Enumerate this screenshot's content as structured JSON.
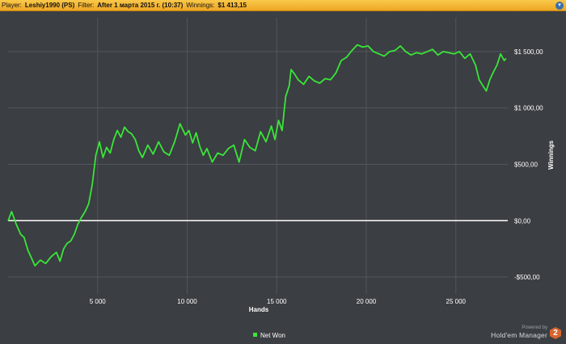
{
  "header": {
    "player_label": "Player:",
    "player_value": "Leshiy1990 (PS)",
    "filter_label": "Filter:",
    "filter_value": "After 1 марта 2015 г. (10:37)",
    "winnings_label": "Winnings:",
    "winnings_value": "$1 413,15",
    "menu_icon": "chevron-down-icon"
  },
  "branding": {
    "powered_by": "Powered by",
    "product": "Hold'em Manager",
    "badge": "2"
  },
  "colors": {
    "background": "#3b3e42",
    "grid": "#53575c",
    "line": "#39e639",
    "zero_line": "#ffffff"
  },
  "chart_data": {
    "type": "line",
    "xlabel": "Hands",
    "ylabel": "Winnings",
    "x_ticks": [
      "5 000",
      "10 000",
      "15 000",
      "20 000",
      "25 000"
    ],
    "x_tick_values": [
      5000,
      10000,
      15000,
      20000,
      25000
    ],
    "y_ticks": [
      "$1 500,00",
      "$1 000,00",
      "$500,00",
      "$0,00",
      "-$500,00"
    ],
    "y_tick_values": [
      1500,
      1000,
      500,
      0,
      -500
    ],
    "xlim": [
      0,
      27900
    ],
    "ylim": [
      -650,
      1800
    ],
    "grid": true,
    "legend_position": "bottom-center",
    "series": [
      {
        "name": "Net Won",
        "x": [
          0,
          200,
          450,
          700,
          900,
          1100,
          1300,
          1500,
          1800,
          2100,
          2400,
          2700,
          2900,
          3100,
          3300,
          3500,
          3700,
          3900,
          4100,
          4300,
          4500,
          4700,
          4900,
          5100,
          5300,
          5500,
          5700,
          5900,
          6100,
          6300,
          6500,
          6700,
          6900,
          7100,
          7300,
          7500,
          7800,
          8100,
          8400,
          8700,
          9000,
          9300,
          9600,
          9900,
          10100,
          10300,
          10500,
          10700,
          10900,
          11100,
          11400,
          11700,
          12000,
          12300,
          12600,
          12900,
          13200,
          13500,
          13800,
          14100,
          14400,
          14700,
          14900,
          15100,
          15300,
          15500,
          15700,
          15800,
          16000,
          16200,
          16500,
          16800,
          17100,
          17400,
          17700,
          18000,
          18300,
          18600,
          18900,
          19200,
          19500,
          19800,
          20100,
          20400,
          20700,
          21000,
          21300,
          21600,
          21900,
          22200,
          22500,
          22800,
          23100,
          23400,
          23700,
          24000,
          24300,
          24600,
          24900,
          25200,
          25500,
          25800,
          26100,
          26300,
          26500,
          26700,
          26900,
          27100,
          27300,
          27500,
          27700,
          27800
        ],
        "y": [
          0,
          80,
          -30,
          -120,
          -150,
          -260,
          -330,
          -400,
          -350,
          -380,
          -320,
          -280,
          -360,
          -250,
          -200,
          -180,
          -120,
          -30,
          30,
          80,
          150,
          320,
          580,
          700,
          560,
          650,
          600,
          720,
          800,
          740,
          830,
          790,
          770,
          720,
          620,
          560,
          670,
          590,
          700,
          610,
          580,
          700,
          860,
          760,
          800,
          690,
          780,
          660,
          580,
          640,
          520,
          600,
          580,
          640,
          670,
          520,
          720,
          650,
          620,
          790,
          700,
          840,
          720,
          890,
          800,
          1100,
          1200,
          1340,
          1300,
          1250,
          1210,
          1280,
          1240,
          1220,
          1260,
          1250,
          1310,
          1420,
          1450,
          1510,
          1560,
          1540,
          1550,
          1500,
          1480,
          1460,
          1500,
          1510,
          1550,
          1500,
          1470,
          1490,
          1480,
          1500,
          1520,
          1470,
          1500,
          1490,
          1480,
          1500,
          1440,
          1480,
          1380,
          1250,
          1200,
          1150,
          1250,
          1320,
          1380,
          1480,
          1420,
          1440
        ]
      }
    ]
  }
}
